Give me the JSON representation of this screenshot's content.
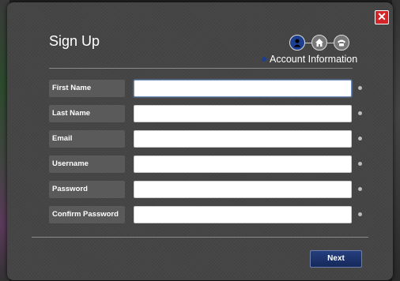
{
  "modal": {
    "title": "Sign Up",
    "step_title": "Account Information",
    "close_symbol": "✕",
    "steps": [
      {
        "icon": "user-icon",
        "active": true
      },
      {
        "icon": "home-icon",
        "active": false
      },
      {
        "icon": "phone-icon",
        "active": false
      }
    ]
  },
  "form": {
    "fields": [
      {
        "label": "First Name",
        "value": ""
      },
      {
        "label": "Last Name",
        "value": ""
      },
      {
        "label": "Email",
        "value": ""
      },
      {
        "label": "Username",
        "value": ""
      },
      {
        "label": "Password",
        "value": ""
      },
      {
        "label": "Confirm Password",
        "value": ""
      }
    ],
    "next_label": "Next"
  },
  "colors": {
    "modal_bg": "#454545",
    "close_red": "#d2252a",
    "next_blue": "#1e3a7a",
    "active_step": "#1e3f8f"
  }
}
